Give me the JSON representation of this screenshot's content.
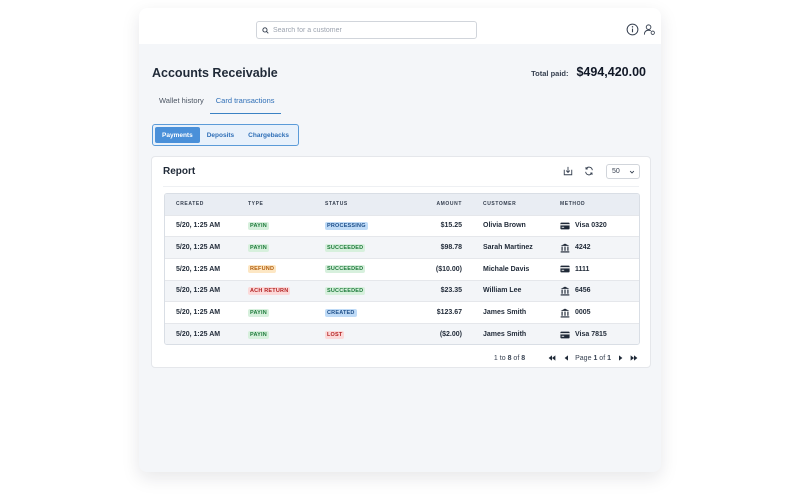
{
  "search": {
    "placeholder": "Search for a customer",
    "value": ""
  },
  "header": {
    "icons": [
      "info-icon",
      "user-settings-icon"
    ]
  },
  "page": {
    "title": "Accounts Receivable",
    "total_label": "Total paid:",
    "total_value": "$494,420.00"
  },
  "tabs": [
    {
      "label": "Wallet history",
      "active": false
    },
    {
      "label": "Card transactions",
      "active": true
    }
  ],
  "subtabs": [
    {
      "label": "Payments",
      "active": true
    },
    {
      "label": "Deposits",
      "active": false
    },
    {
      "label": "Chargebacks",
      "active": false
    }
  ],
  "report": {
    "title": "Report",
    "page_size": "50",
    "columns": [
      "CREATED",
      "TYPE",
      "STATUS",
      "AMOUNT",
      "CUSTOMER",
      "METHOD"
    ],
    "rows": [
      {
        "created": "5/20, 1:25 AM",
        "type": "PAYIN",
        "status": "PROCESSING",
        "amount": "$15.25",
        "customer": "Olivia Brown",
        "method_icon": "card-icon",
        "method": "Visa 0320"
      },
      {
        "created": "5/20, 1:25 AM",
        "type": "PAYIN",
        "status": "SUCCEEDED",
        "amount": "$98.78",
        "customer": "Sarah Martinez",
        "method_icon": "bank-icon",
        "method": "4242"
      },
      {
        "created": "5/20, 1:25 AM",
        "type": "REFUND",
        "status": "SUCCEEDED",
        "amount": "($10.00)",
        "customer": "Michale Davis",
        "method_icon": "card-icon",
        "method": "1111"
      },
      {
        "created": "5/20, 1:25 AM",
        "type": "ACH RETURN",
        "status": "SUCCEEDED",
        "amount": "$23.35",
        "customer": "William Lee",
        "method_icon": "bank-icon",
        "method": "6456"
      },
      {
        "created": "5/20, 1:25 AM",
        "type": "PAYIN",
        "status": "CREATED",
        "amount": "$123.67",
        "customer": "James Smith",
        "method_icon": "bank-icon",
        "method": "0005"
      },
      {
        "created": "5/20, 1:25 AM",
        "type": "PAYIN",
        "status": "LOST",
        "amount": "($2.00)",
        "customer": "James Smith",
        "method_icon": "card-icon",
        "method": "Visa 7815"
      }
    ],
    "pager": {
      "range_from": "1",
      "range_to_word": "to",
      "range_to": "8",
      "of_word": "of",
      "total": "8",
      "page_word": "Page",
      "page": "1",
      "page_of_word": "of",
      "pages": "1"
    }
  },
  "colors": {
    "accent": "#4a90d9",
    "badge_green": "#1d7a3a",
    "badge_orange": "#b25d0b",
    "badge_red": "#b42323",
    "badge_blue": "#1e4f8a"
  }
}
